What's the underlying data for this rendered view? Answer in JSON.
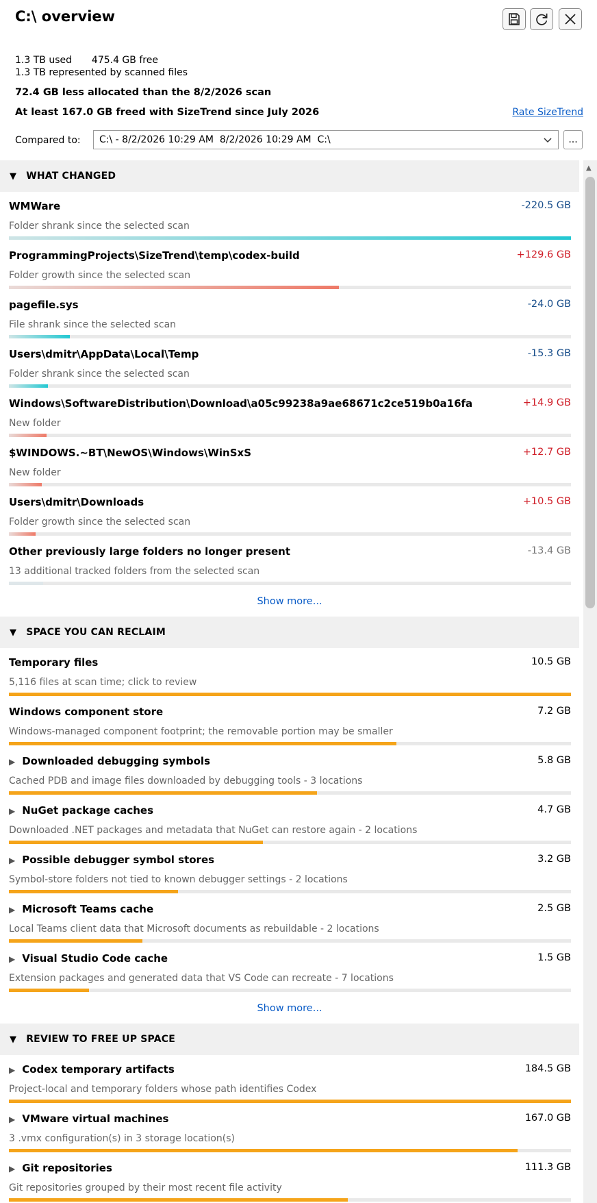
{
  "header": {
    "title": "C:\\ overview",
    "used": "1.3 TB used",
    "free": "475.4 GB free",
    "represented": "1.3 TB represented by scanned files",
    "allocated": "72.4 GB less allocated than the 8/2/2026 scan",
    "freed": "At least 167.0 GB freed with SizeTrend since July 2026",
    "rate_link": "Rate SizeTrend",
    "compared_label": "Compared to:",
    "compared_value": "C:\\ - 8/2/2026 10:29 AM  8/2/2026 10:29 AM  C:\\",
    "dots": "..."
  },
  "sections": [
    {
      "title": "WHAT CHANGED",
      "items": [
        {
          "name": "WMWare",
          "size": "-220.5 GB",
          "desc": "Folder shrank since the selected scan",
          "fraction": 1.0,
          "kind": "shrink"
        },
        {
          "name": "ProgrammingProjects\\SizeTrend\\temp\\codex-build",
          "size": "+129.6 GB",
          "desc": "Folder growth since the selected scan",
          "fraction": 0.587,
          "kind": "growth"
        },
        {
          "name": "pagefile.sys",
          "size": "-24.0 GB",
          "desc": "File shrank since the selected scan",
          "fraction": 0.109,
          "kind": "shrink"
        },
        {
          "name": "Users\\dmitr\\AppData\\Local\\Temp",
          "size": "-15.3 GB",
          "desc": "Folder shrank since the selected scan",
          "fraction": 0.069,
          "kind": "shrink"
        },
        {
          "name": "Windows\\SoftwareDistribution\\Download\\a05c99238a9ae68671c2ce519b0a16fa",
          "size": "+14.9 GB",
          "desc": "New folder",
          "fraction": 0.067,
          "kind": "growth"
        },
        {
          "name": "$WINDOWS.~BT\\NewOS\\Windows\\WinSxS",
          "size": "+12.7 GB",
          "desc": "New folder",
          "fraction": 0.058,
          "kind": "growth"
        },
        {
          "name": "Users\\dmitr\\Downloads",
          "size": "+10.5 GB",
          "desc": "Folder growth since the selected scan",
          "fraction": 0.048,
          "kind": "growth"
        },
        {
          "name": "Other previously large folders no longer present",
          "size": "-13.4 GB",
          "desc": "13 additional tracked folders from the selected scan",
          "fraction": 0.061,
          "kind": "neutral"
        }
      ],
      "show_more": "Show more..."
    },
    {
      "title": "SPACE YOU CAN RECLAIM",
      "items": [
        {
          "name": "Temporary files",
          "size": "10.5 GB",
          "desc": "5,116 files at scan time; click to review",
          "fraction": 1.0,
          "kind": "reclaim",
          "expandable": false
        },
        {
          "name": "Windows component store",
          "size": "7.2 GB",
          "desc": "Windows-managed component footprint; the removable portion may be smaller",
          "fraction": 0.69,
          "kind": "reclaim",
          "expandable": false
        },
        {
          "name": "Downloaded debugging symbols",
          "size": "5.8 GB",
          "desc": "Cached PDB and image files downloaded by debugging tools - 3 locations",
          "fraction": 0.548,
          "kind": "reclaim",
          "expandable": true
        },
        {
          "name": "NuGet package caches",
          "size": "4.7 GB",
          "desc": "Downloaded .NET packages and metadata that NuGet can restore again - 2 locations",
          "fraction": 0.452,
          "kind": "reclaim",
          "expandable": true
        },
        {
          "name": "Possible debugger symbol stores",
          "size": "3.2 GB",
          "desc": "Symbol-store folders not tied to known debugger settings - 2 locations",
          "fraction": 0.301,
          "kind": "reclaim",
          "expandable": true
        },
        {
          "name": "Microsoft Teams cache",
          "size": "2.5 GB",
          "desc": "Local Teams client data that Microsoft documents as rebuildable - 2 locations",
          "fraction": 0.237,
          "kind": "reclaim",
          "expandable": true
        },
        {
          "name": "Visual Studio Code cache",
          "size": "1.5 GB",
          "desc": "Extension packages and generated data that VS Code can recreate - 7 locations",
          "fraction": 0.142,
          "kind": "reclaim",
          "expandable": true
        }
      ],
      "show_more": "Show more..."
    },
    {
      "title": "REVIEW TO FREE UP SPACE",
      "items": [
        {
          "name": "Codex temporary artifacts",
          "size": "184.5 GB",
          "desc": "Project-local and temporary folders whose path identifies Codex",
          "fraction": 1.0,
          "kind": "reclaim",
          "expandable": true
        },
        {
          "name": "VMware virtual machines",
          "size": "167.0 GB",
          "desc": "3 .vmx configuration(s) in 3 storage location(s)",
          "fraction": 0.905,
          "kind": "reclaim",
          "expandable": true
        },
        {
          "name": "Git repositories",
          "size": "111.3 GB",
          "desc": "Git repositories grouped by their most recent file activity",
          "fraction": 0.603,
          "kind": "reclaim",
          "expandable": true
        }
      ]
    }
  ],
  "colors": {
    "shrink_text": "#1a4f8b",
    "growth_text": "#d0202a",
    "neutral_text": "#777777",
    "reclaim_text": "#000000",
    "shrink_bar": "#22c8d2",
    "growth_bar": "#ee7a68",
    "neutral_bar": "#dfe7ea",
    "reclaim_bar": "#f5a41a",
    "link": "#0a5cc7"
  },
  "icons": {
    "save": "save-icon",
    "refresh": "refresh-icon",
    "close": "close-icon",
    "collapse": "▼",
    "expand": "▶"
  }
}
